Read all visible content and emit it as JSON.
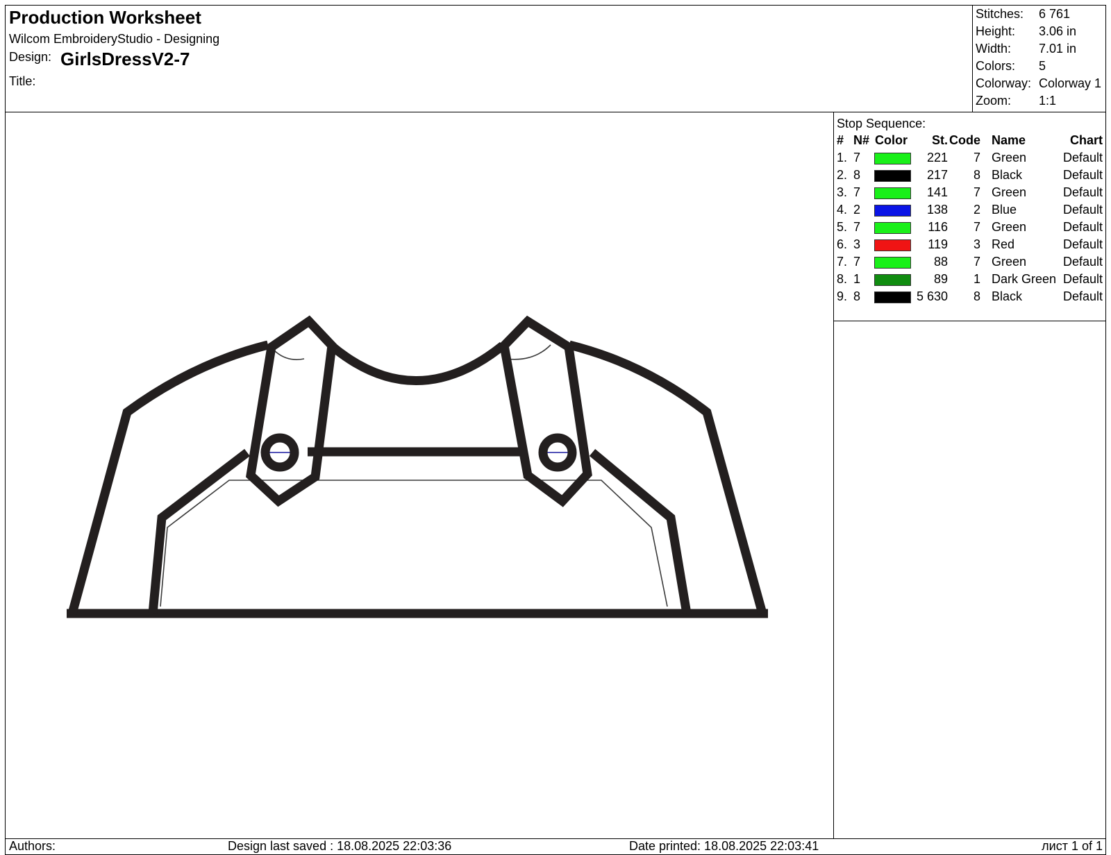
{
  "header": {
    "sheet_title": "Production Worksheet",
    "software": "Wilcom EmbroideryStudio - Designing",
    "design_label": "Design:",
    "design_name": "GirlsDressV2-7",
    "title_label": "Title:"
  },
  "stats": [
    {
      "label": "Stitches:",
      "value": "6 761"
    },
    {
      "label": "Height:",
      "value": "3.06 in"
    },
    {
      "label": "Width:",
      "value": "7.01 in"
    },
    {
      "label": "Colors:",
      "value": "5"
    },
    {
      "label": "Colorway:",
      "value": "Colorway 1"
    },
    {
      "label": "Zoom:",
      "value": "1:1"
    }
  ],
  "stop_sequence": {
    "title": "Stop Sequence:",
    "headers": {
      "num": "#",
      "n": "N#",
      "color": "Color",
      "st": "St.",
      "code": "Code",
      "name": "Name",
      "chart": "Chart"
    },
    "rows": [
      {
        "num": "1.",
        "n": "7",
        "color": "#19f019",
        "st": "221",
        "code": "7",
        "name": "Green",
        "chart": "Default"
      },
      {
        "num": "2.",
        "n": "8",
        "color": "#000000",
        "st": "217",
        "code": "8",
        "name": "Black",
        "chart": "Default"
      },
      {
        "num": "3.",
        "n": "7",
        "color": "#19f019",
        "st": "141",
        "code": "7",
        "name": "Green",
        "chart": "Default"
      },
      {
        "num": "4.",
        "n": "2",
        "color": "#0a14e6",
        "st": "138",
        "code": "2",
        "name": "Blue",
        "chart": "Default"
      },
      {
        "num": "5.",
        "n": "7",
        "color": "#19f019",
        "st": "116",
        "code": "7",
        "name": "Green",
        "chart": "Default"
      },
      {
        "num": "6.",
        "n": "3",
        "color": "#f01414",
        "st": "119",
        "code": "3",
        "name": "Red",
        "chart": "Default"
      },
      {
        "num": "7.",
        "n": "7",
        "color": "#19f019",
        "st": "88",
        "code": "7",
        "name": "Green",
        "chart": "Default"
      },
      {
        "num": "8.",
        "n": "1",
        "color": "#108c10",
        "st": "89",
        "code": "1",
        "name": "Dark Green",
        "chart": "Default"
      },
      {
        "num": "9.",
        "n": "8",
        "color": "#000000",
        "st": "5 630",
        "code": "8",
        "name": "Black",
        "chart": "Default"
      }
    ]
  },
  "footer": {
    "authors_label": "Authors:",
    "last_saved": "Design last saved : 18.08.2025 22:03:36",
    "date_printed": "Date printed: 18.08.2025 22:03:41",
    "page_info": "лист 1 of 1"
  },
  "design": {
    "stitch_color": "#231f1f",
    "placement_color": "#3a3a3a",
    "accent_color": "#1a1aa0"
  }
}
